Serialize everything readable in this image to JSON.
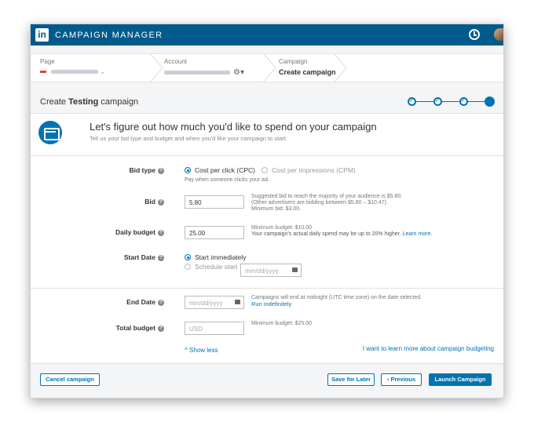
{
  "topbar": {
    "logo": "in",
    "title": "CAMPAIGN MANAGER"
  },
  "breadcrumb": {
    "page_label": "Page",
    "account_label": "Account",
    "campaign_label": "Campaign",
    "campaign_value": "Create campaign"
  },
  "header": {
    "prefix": "Create ",
    "bold": "Testing",
    "suffix": " campaign"
  },
  "intro": {
    "title": "Let's figure out how much you'd like to spend on your campaign",
    "subtitle": "Tell us your bid type and budget and when you'd like your campaign to start."
  },
  "form": {
    "bid_type": {
      "label": "Bid type",
      "option_cpc": "Cost per click (CPC)",
      "option_cpm": "Cost per impressions (CPM)",
      "note": "Pay when someone clicks your ad."
    },
    "bid": {
      "label": "Bid",
      "value": "5.80",
      "note1": "Suggested bid to reach the majority of your audience is $5.80.",
      "note2": "(Other advertisers are bidding between $5.80 – $10.47)",
      "note3": "Minimum bid: $3.00."
    },
    "daily_budget": {
      "label": "Daily budget",
      "value": "25.00",
      "note1": "Minimum budget: $10.00",
      "note2": "Your campaign's actual daily spend may be up to 20% higher. ",
      "note_link": "Learn more."
    },
    "start_date": {
      "label": "Start Date",
      "option_immediately": "Start immediately",
      "option_schedule": "Schedule start",
      "placeholder": "mm/dd/yyyy"
    },
    "end_date": {
      "label": "End Date",
      "placeholder": "mm/dd/yyyy",
      "note": "Campaigns will end at midnight (UTC time zone) on the date selected.",
      "link": "Run indefinitely"
    },
    "total_budget": {
      "label": "Total budget",
      "placeholder": "USD",
      "note": "Minimum budget: $25.00"
    },
    "show_less": "Show less",
    "learn_more": "I want to learn more about campaign budgeting"
  },
  "footer": {
    "cancel": "Cancel campaign",
    "save": "Save for Later",
    "previous": "‹ Previous",
    "launch": "Launch Campaign"
  },
  "icons": {
    "logo": "linkedin-logo",
    "history": "clock-icon",
    "settings": "gear-icon",
    "calendar": "calendar-icon",
    "help": "question-icon",
    "intro": "credit-card-icon"
  },
  "colors": {
    "brand": "#005a8c",
    "accent": "#0073b1"
  }
}
